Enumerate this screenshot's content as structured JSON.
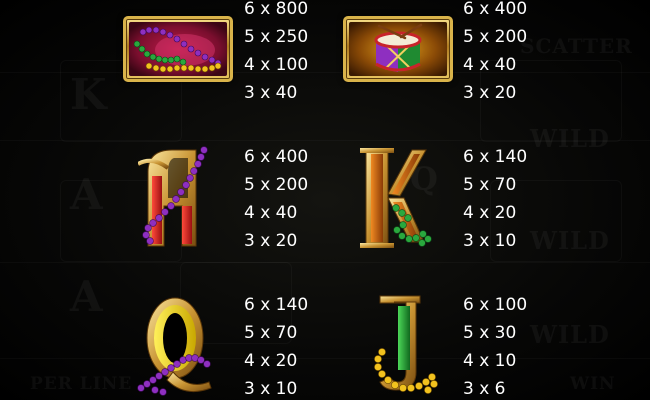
{
  "background": {
    "ghost_texts": [
      "K",
      "A",
      "A",
      "Q",
      "SCATTER",
      "WILD",
      "WILD",
      "WILD",
      "PER LINE",
      "WIN"
    ]
  },
  "colors": {
    "text": "#ffffff",
    "gold": "#d9b34a",
    "purple": "#8e2fc0",
    "green": "#1f9a34",
    "red": "#c81e24",
    "yellow": "#f2d200"
  },
  "paytable": [
    {
      "symbol": "mardi-gras-beads-icon",
      "pays": [
        "6 x 800",
        "5 x 250",
        "4 x 100",
        "3 x 40"
      ]
    },
    {
      "symbol": "drum-icon",
      "pays": [
        "6 x 400",
        "5 x 200",
        "4 x 40",
        "3 x 20"
      ]
    },
    {
      "symbol": "letter-a-icon",
      "pays": [
        "6 x 400",
        "5 x 200",
        "4 x 40",
        "3 x 20"
      ]
    },
    {
      "symbol": "letter-k-icon",
      "pays": [
        "6 x 140",
        "5 x 70",
        "4 x 20",
        "3 x 10"
      ]
    },
    {
      "symbol": "letter-q-icon",
      "pays": [
        "6 x 140",
        "5 x 70",
        "4 x 20",
        "3 x 10"
      ]
    },
    {
      "symbol": "letter-j-icon",
      "pays": [
        "6 x 100",
        "5 x 30",
        "4 x 10",
        "3 x 6"
      ]
    }
  ]
}
